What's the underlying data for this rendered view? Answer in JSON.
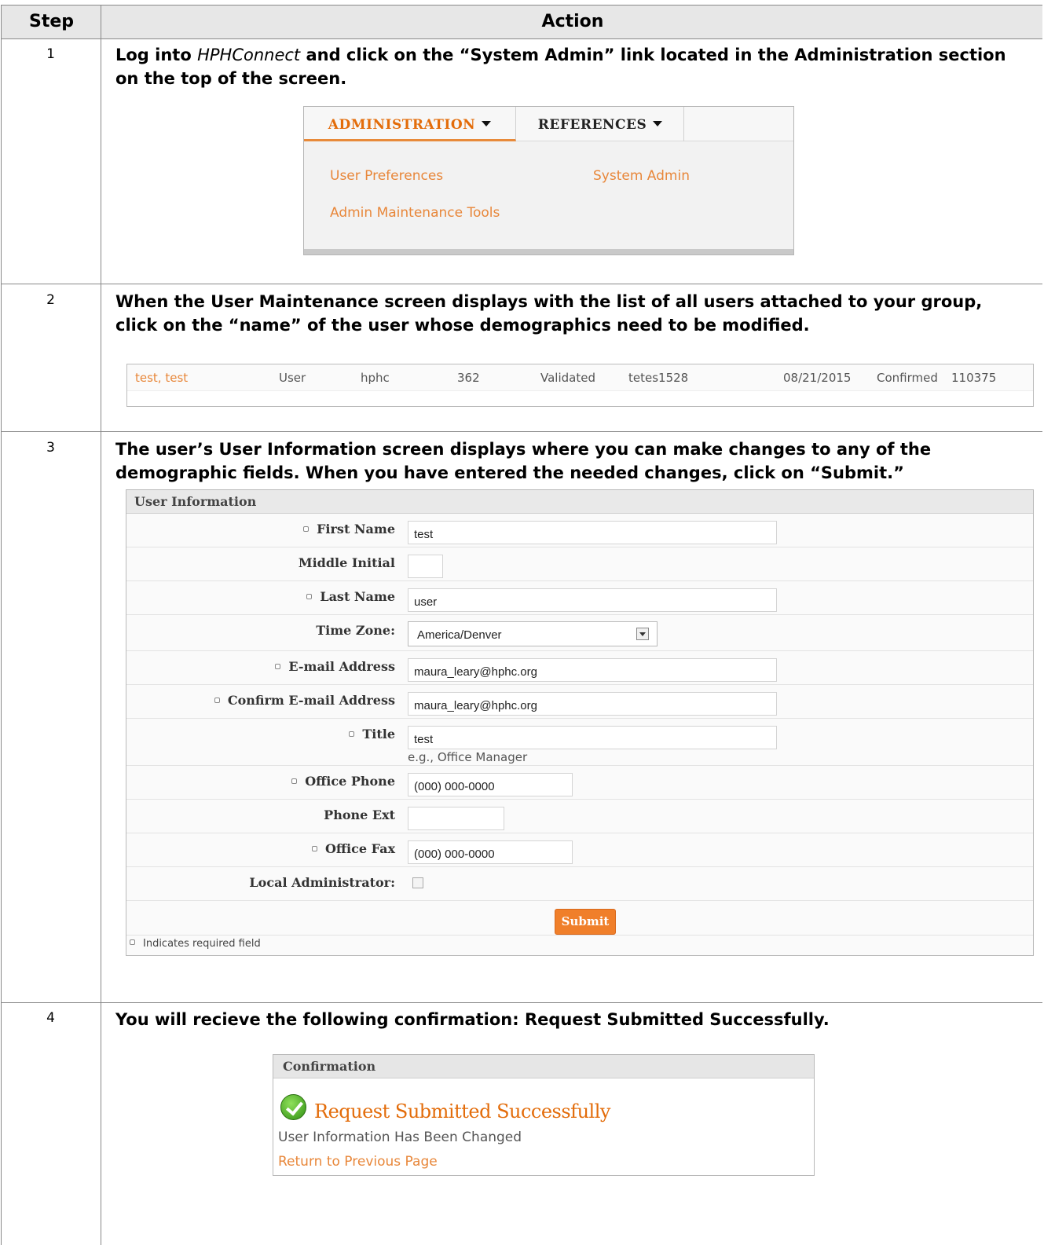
{
  "table": {
    "header_step": "Step",
    "header_action": "Action"
  },
  "steps": [
    {
      "num": "1",
      "text_before": "Log into ",
      "text_italic": "HPHConnect",
      "text_after": " and click on the “System Admin” link located in the Administration section on the top of the screen."
    },
    {
      "num": "2",
      "text": "When the User Maintenance screen displays with the list of all users attached to your group, click on the “name” of the user whose demographics need to be modified."
    },
    {
      "num": "3",
      "text": "The user’s User Information screen displays where you can make changes to any of the demographic fields. When you have entered the needed changes, click on “Submit.”"
    },
    {
      "num": "4",
      "text": "You will recieve the following confirmation:  Request Submitted Successfully."
    }
  ],
  "menu": {
    "tab_admin": "ADMINISTRATION",
    "tab_references": "REFERENCES",
    "link_user_prefs": "User Preferences",
    "link_system_admin": "System Admin",
    "link_admin_tools": "Admin Maintenance Tools"
  },
  "user_row": {
    "name": "test, test",
    "role": "User",
    "org": "hphc",
    "id": "362",
    "status": "Validated",
    "username": "tetes1528",
    "date": "08/21/2015",
    "confirm_status": "Confirmed",
    "number": "110375"
  },
  "user_form": {
    "title": "User Information",
    "first_name_label": "First Name",
    "first_name_value": "test",
    "middle_initial_label": "Middle Initial",
    "middle_initial_value": "",
    "last_name_label": "Last Name",
    "last_name_value": "user",
    "time_zone_label": "Time Zone:",
    "time_zone_value": "America/Denver",
    "email_label": "E-mail Address",
    "email_value": "maura_leary@hphc.org",
    "confirm_email_label": "Confirm E-mail Address",
    "confirm_email_value": "maura_leary@hphc.org",
    "title_label": "Title",
    "title_value": "test",
    "title_hint": "e.g., Office Manager",
    "office_phone_label": "Office Phone",
    "office_phone_value": "(000) 000-0000",
    "phone_ext_label": "Phone Ext",
    "phone_ext_value": "",
    "office_fax_label": "Office Fax",
    "office_fax_value": "(000) 000-0000",
    "local_admin_label": "Local Administrator:",
    "submit_label": "Submit",
    "required_note": "Indicates required field"
  },
  "confirmation": {
    "header": "Confirmation",
    "title": "Request Submitted Successfully",
    "message": "User Information Has Been Changed",
    "link": "Return to Previous Page"
  }
}
